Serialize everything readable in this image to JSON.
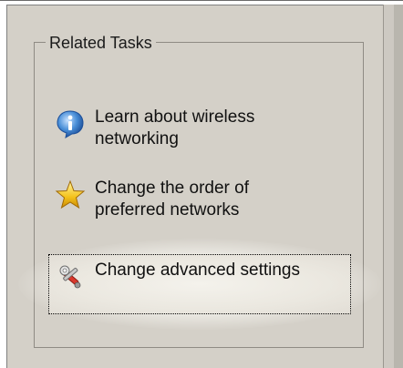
{
  "related_tasks": {
    "title": "Related Tasks",
    "items": [
      {
        "label": "Learn about wireless networking",
        "icon": "info-icon"
      },
      {
        "label": "Change the order of preferred networks",
        "icon": "star-icon"
      },
      {
        "label": "Change advanced settings",
        "icon": "settings-tools-icon"
      }
    ]
  }
}
